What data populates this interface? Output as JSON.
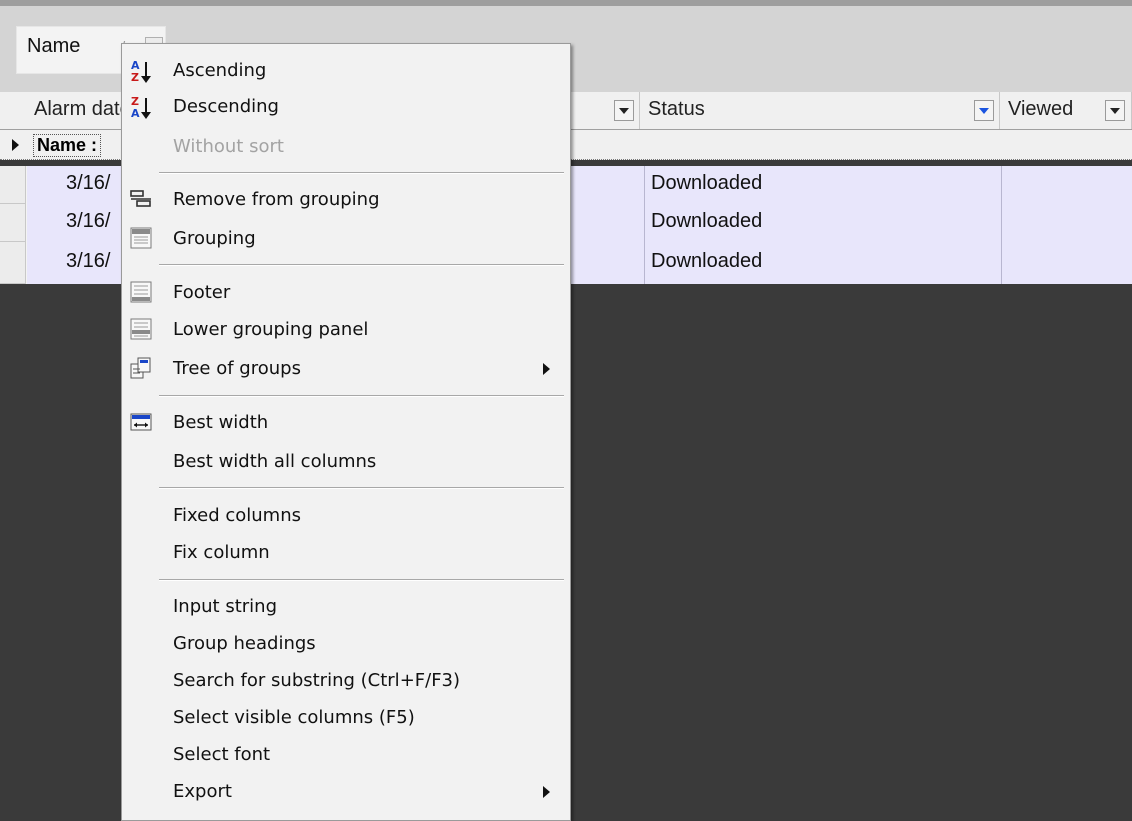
{
  "group_panel": {
    "chip_label": "Name",
    "sort_indicator": "/"
  },
  "columns": [
    {
      "label": "Alarm date"
    },
    {
      "label": "Status",
      "filter_active": true
    },
    {
      "label": "Viewed"
    }
  ],
  "group_row": {
    "label": "Name :"
  },
  "rows": [
    {
      "date": "3/16/",
      "status": "Downloaded"
    },
    {
      "date": "3/16/",
      "status": "Downloaded"
    },
    {
      "date": "3/16/",
      "status": "Downloaded"
    }
  ],
  "menu": {
    "ascending": "Ascending",
    "descending": "Descending",
    "without_sort": "Without sort",
    "remove_from_grouping": "Remove from grouping",
    "grouping": "Grouping",
    "footer": "Footer",
    "lower_grouping_panel": "Lower grouping panel",
    "tree_of_groups": "Tree of groups",
    "best_width": "Best width",
    "best_width_all": "Best width all columns",
    "fixed_columns": "Fixed columns",
    "fix_column": "Fix column",
    "input_string": "Input string",
    "group_headings": "Group headings",
    "search_substring": "Search for substring (Ctrl+F/F3)",
    "select_visible_columns": "Select visible columns (F5)",
    "select_font": "Select font",
    "export": "Export"
  },
  "colors": {
    "menu_bg": "#f2f2f2",
    "row_highlight": "#e8e6fb",
    "workspace": "#3a3a3a",
    "disabled_text": "#a3a3a3",
    "filter_arrow": "#1a54e0"
  },
  "icons": {
    "ascending": "sort-ascending-icon",
    "descending": "sort-descending-icon",
    "remove_from_grouping": "remove-grouping-icon",
    "grouping": "grouping-panel-icon",
    "footer": "footer-icon",
    "lower_grouping_panel": "lower-grouping-panel-icon",
    "tree_of_groups": "tree-of-groups-icon",
    "best_width": "best-width-icon"
  }
}
